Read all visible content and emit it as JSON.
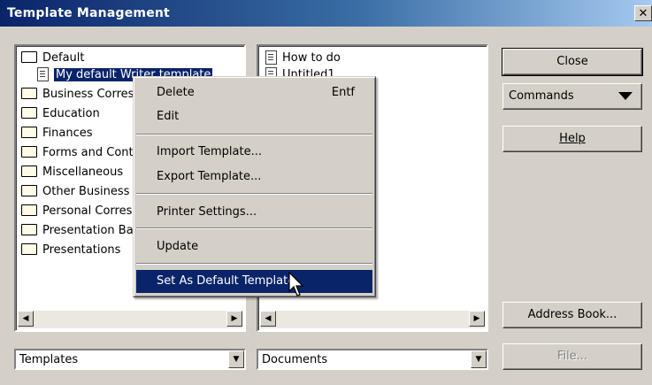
{
  "window": {
    "title": "Template Management",
    "close_glyph": "✕"
  },
  "left_tree": {
    "items": [
      {
        "label": "Default",
        "icon": "folder-open-icon"
      },
      {
        "label": "My default Writer template",
        "icon": "document-icon",
        "selected": true
      },
      {
        "label": "Business Correspondence",
        "icon": "folder-icon"
      },
      {
        "label": "Education",
        "icon": "folder-icon"
      },
      {
        "label": "Finances",
        "icon": "folder-icon"
      },
      {
        "label": "Forms and Contracts",
        "icon": "folder-icon"
      },
      {
        "label": "Miscellaneous",
        "icon": "folder-icon"
      },
      {
        "label": "Other Business Documents",
        "icon": "folder-icon"
      },
      {
        "label": "Personal Correspondence and Documents",
        "icon": "folder-icon"
      },
      {
        "label": "Presentation Backgrounds",
        "icon": "folder-icon"
      },
      {
        "label": "Presentations",
        "icon": "folder-icon"
      }
    ],
    "combo_value": "Templates"
  },
  "right_list": {
    "items": [
      {
        "label": "How to do",
        "icon": "document-icon"
      },
      {
        "label": "Untitled1",
        "icon": "document-icon"
      }
    ],
    "combo_value": "Documents"
  },
  "buttons": {
    "close": "Close",
    "commands": "Commands",
    "help": "Help",
    "address_book": "Address Book...",
    "file": "File..."
  },
  "context_menu": {
    "delete": "Delete",
    "delete_key": "Entf",
    "edit": "Edit",
    "import": "Import Template...",
    "export": "Export Template...",
    "printer": "Printer Settings...",
    "update": "Update",
    "set_default": "Set As Default Template"
  },
  "colors": {
    "selection": "#0a246a",
    "face": "#d4d0c8"
  }
}
